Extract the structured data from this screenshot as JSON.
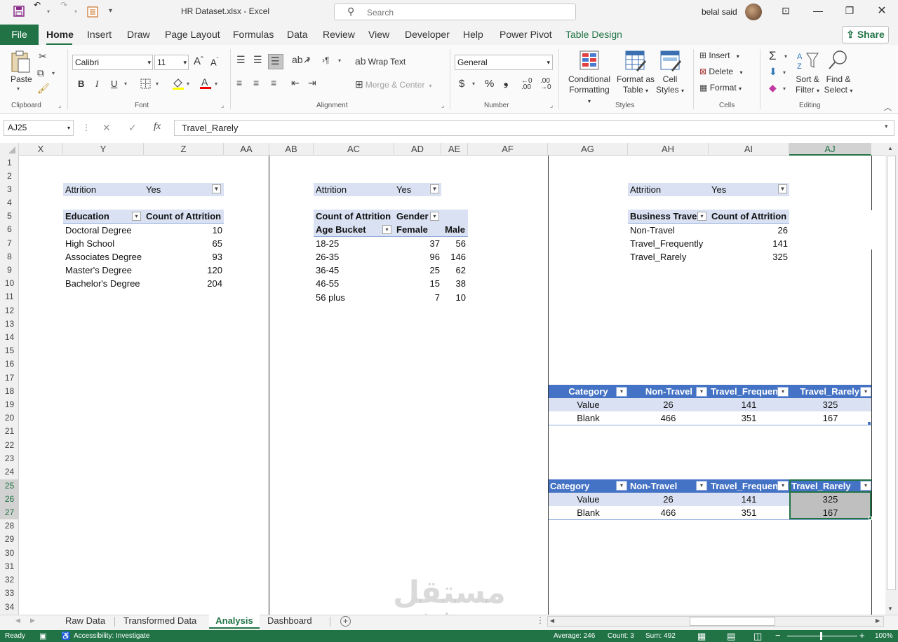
{
  "titlebar": {
    "title": "HR Dataset.xlsx  -  Excel",
    "search_placeholder": "Search",
    "user_name": "belal said"
  },
  "ribbon_tabs": [
    "File",
    "Home",
    "Insert",
    "Draw",
    "Page Layout",
    "Formulas",
    "Data",
    "Review",
    "View",
    "Developer",
    "Help",
    "Power Pivot",
    "Table Design"
  ],
  "share_label": "Share",
  "ribbon": {
    "clipboard": {
      "paste": "Paste",
      "label": "Clipboard"
    },
    "font": {
      "name": "Calibri",
      "size": "11",
      "label": "Font",
      "bold": "B",
      "italic": "I",
      "underline": "U"
    },
    "alignment": {
      "wrap": "Wrap Text",
      "merge": "Merge & Center",
      "label": "Alignment"
    },
    "number": {
      "format": "General",
      "label": "Number"
    },
    "styles": {
      "cond1": "Conditional",
      "cond2": "Formatting",
      "fmt1": "Format as",
      "fmt2": "Table",
      "cell1": "Cell",
      "cell2": "Styles",
      "label": "Styles"
    },
    "cells": {
      "insert": "Insert",
      "delete": "Delete",
      "format": "Format",
      "label": "Cells"
    },
    "editing": {
      "sort1": "Sort &",
      "sort2": "Filter",
      "find1": "Find &",
      "find2": "Select",
      "label": "Editing"
    }
  },
  "formula_bar": {
    "name_box": "AJ25",
    "fx": "fx",
    "formula": "Travel_Rarely"
  },
  "columns": [
    "X",
    "Y",
    "Z",
    "AA",
    "AB",
    "AC",
    "AD",
    "AE",
    "AF",
    "AG",
    "AH",
    "AI",
    "AJ"
  ],
  "rows": [
    "1",
    "2",
    "3",
    "4",
    "5",
    "6",
    "7",
    "8",
    "9",
    "10",
    "11",
    "12",
    "13",
    "14",
    "15",
    "16",
    "17",
    "18",
    "19",
    "20",
    "21",
    "22",
    "23",
    "24",
    "25",
    "26",
    "27",
    "28",
    "29",
    "30",
    "31",
    "32",
    "33",
    "34"
  ],
  "pivot_education": {
    "filter_label": "Attrition",
    "filter_value": "Yes",
    "headers": [
      "Education",
      "Count of Attrition"
    ],
    "rows": [
      [
        "Doctoral Degree",
        "10"
      ],
      [
        "High School",
        "65"
      ],
      [
        "Associates Degree",
        "93"
      ],
      [
        "Master's Degree",
        "120"
      ],
      [
        "Bachelor's Degree",
        "204"
      ]
    ]
  },
  "pivot_age": {
    "filter_label": "Attrition",
    "filter_value": "Yes",
    "top_left": "Count of Attrition",
    "top_right": "Gender",
    "headers": [
      "Age Bucket",
      "Female",
      "Male"
    ],
    "rows": [
      [
        "18-25",
        "37",
        "56"
      ],
      [
        "26-35",
        "96",
        "146"
      ],
      [
        "36-45",
        "25",
        "62"
      ],
      [
        "46-55",
        "15",
        "38"
      ],
      [
        "56 plus",
        "7",
        "10"
      ]
    ]
  },
  "pivot_travel": {
    "filter_label": "Attrition",
    "filter_value": "Yes",
    "headers": [
      "Business Travel",
      "Count of Attrition"
    ],
    "rows": [
      [
        "Non-Travel",
        "26"
      ],
      [
        "Travel_Frequently",
        "141"
      ],
      [
        "Travel_Rarely",
        "325"
      ]
    ]
  },
  "table1": {
    "headers": [
      "Category",
      "Non-Travel",
      "Travel_Frequen",
      "Travel_Rarely"
    ],
    "rows": [
      [
        "Value",
        "26",
        "141",
        "325"
      ],
      [
        "Blank",
        "466",
        "351",
        "167"
      ]
    ]
  },
  "table2": {
    "headers": [
      "Category",
      "Non-Travel",
      "Travel_Frequen",
      "Travel_Rarely"
    ],
    "rows": [
      [
        "Value",
        "26",
        "141",
        "325"
      ],
      [
        "Blank",
        "466",
        "351",
        "167"
      ]
    ]
  },
  "sheets": [
    "Raw Data",
    "Transformed Data",
    "Analysis",
    "Dashboard"
  ],
  "status": {
    "ready": "Ready",
    "accessibility": "Accessibility: Investigate",
    "average": "Average: 246",
    "count": "Count: 3",
    "sum": "Sum: 492",
    "zoom": "100%"
  },
  "watermark": {
    "ar": "مستقل",
    "en": "mostaql.com"
  },
  "colors": {
    "excel_green": "#217346",
    "table_blue": "#4472c4",
    "band_blue": "#d9e1f2"
  }
}
